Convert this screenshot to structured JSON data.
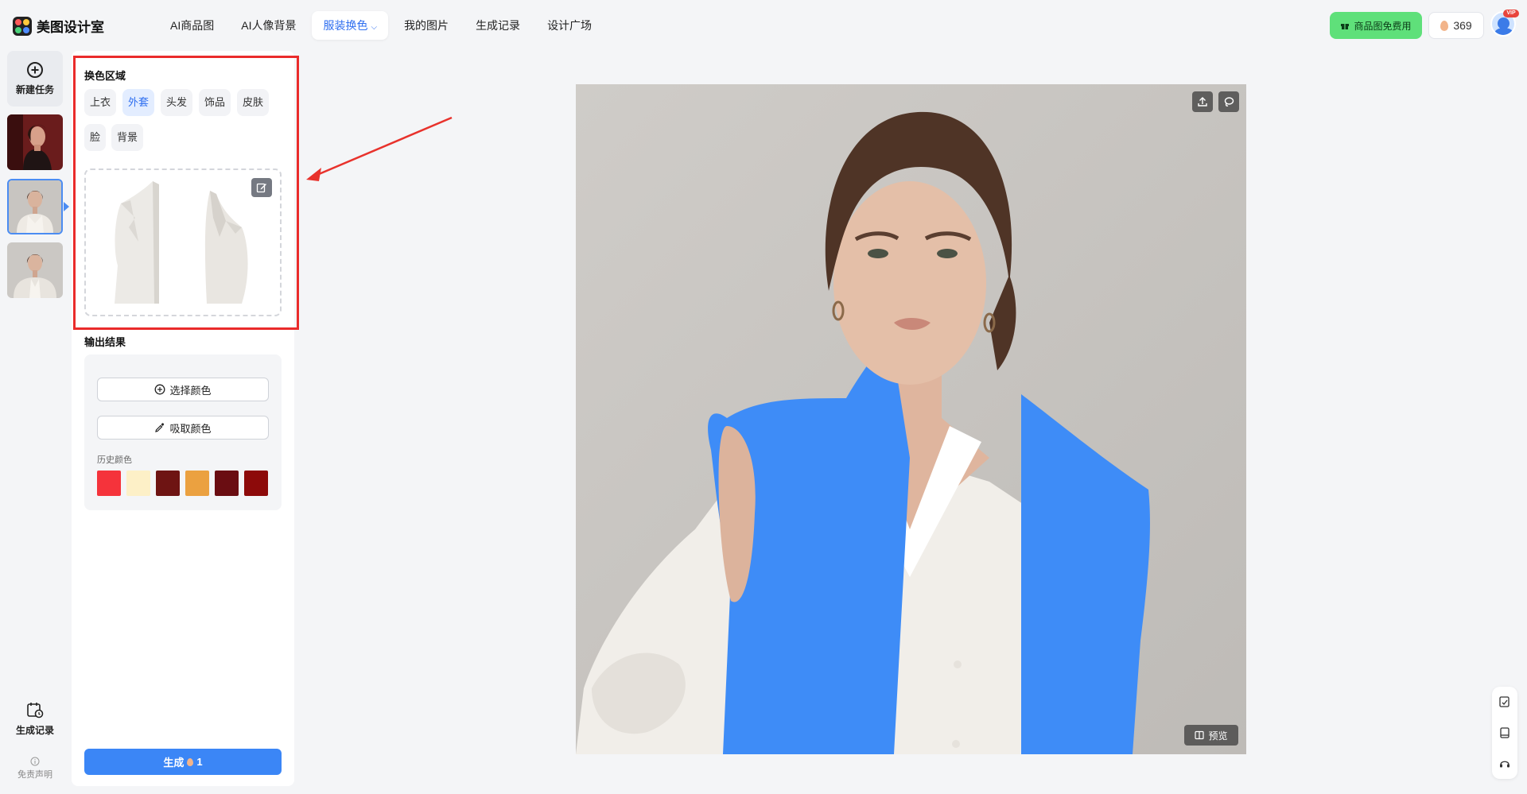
{
  "app": {
    "name": "美图设计室"
  },
  "nav": {
    "items": [
      {
        "label": "AI商品图"
      },
      {
        "label": "AI人像背景"
      },
      {
        "label": "服装换色",
        "active": true
      },
      {
        "label": "我的图片"
      },
      {
        "label": "生成记录"
      },
      {
        "label": "设计广场"
      }
    ]
  },
  "header": {
    "vip_button": "商品图免费用",
    "credits": "369",
    "vip_badge": "VIP"
  },
  "sidebar": {
    "new_task": "新建任务",
    "history": "生成记录",
    "disclaimer": "免责声明",
    "thumbnails": [
      {
        "icon": "portrait-red-background"
      },
      {
        "icon": "portrait-white-shirt",
        "selected": true
      },
      {
        "icon": "portrait-white-blazer"
      }
    ]
  },
  "panel": {
    "region_title": "换色区域",
    "regions": [
      {
        "label": "上衣"
      },
      {
        "label": "外套",
        "active": true
      },
      {
        "label": "头发"
      },
      {
        "label": "饰品"
      },
      {
        "label": "皮肤"
      },
      {
        "label": "脸"
      },
      {
        "label": "背景"
      }
    ],
    "output_title": "输出结果",
    "choose_color": "选择颜色",
    "pick_color": "吸取颜色",
    "history_colors_label": "历史颜色",
    "history_colors": [
      "#f5333b",
      "#fdf0c7",
      "#6e1413",
      "#eba140",
      "#6a0d12",
      "#8d0a0a"
    ],
    "generate_label": "生成",
    "generate_cost": "1"
  },
  "canvas": {
    "preview_label": "预览",
    "mask_color": "#3e8cf7"
  }
}
